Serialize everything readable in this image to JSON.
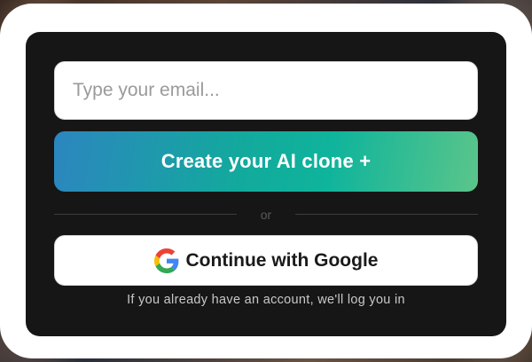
{
  "signup": {
    "email_placeholder": "Type your email...",
    "email_value": "",
    "create_button_label": "Create your AI clone +",
    "divider_text": "or",
    "google_button_label": "Continue with Google",
    "google_icon": "google-g-logo",
    "login_note": "If you already have an account, we'll log you in"
  },
  "colors": {
    "card_background": "#161616",
    "frame_background": "#ffffff",
    "gradient_start": "#2c86bf",
    "gradient_mid": "#12aa9c",
    "gradient_end": "#5bc58a"
  }
}
